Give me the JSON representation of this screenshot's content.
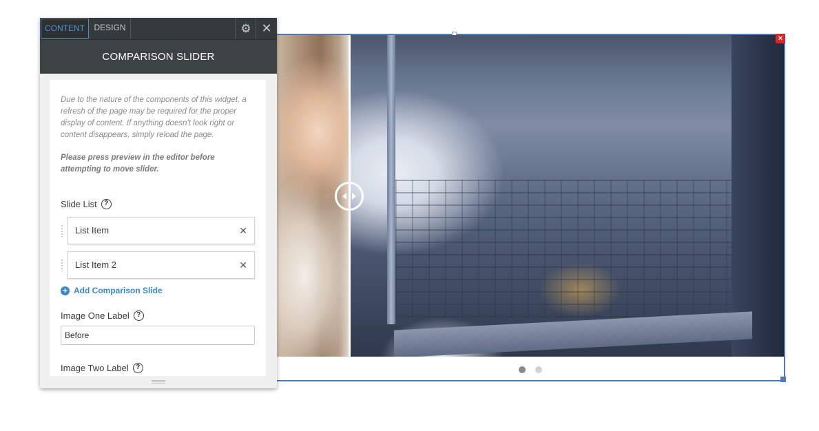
{
  "panel": {
    "tabs": {
      "content": "CONTENT",
      "design": "DESIGN"
    },
    "title": "COMPARISON SLIDER",
    "notice": "Due to the nature of the components of this widget, a refresh of the page may be required for the proper display of content. If anything doesn't look right or content disappears, simply reload the page.",
    "notice_bold": "Please press preview in the editor before attempting to move slider.",
    "slide_list": {
      "label": "Slide List",
      "items": [
        {
          "label": "List Item"
        },
        {
          "label": "List Item 2"
        }
      ],
      "add_label": "Add Comparison Slide"
    },
    "image_one": {
      "label": "Image One Label",
      "value": "Before"
    },
    "image_two": {
      "label": "Image Two Label",
      "value": ""
    }
  },
  "icons": {
    "gear": "gear-icon",
    "close": "close-icon",
    "help": "help-icon",
    "remove": "remove-icon",
    "add": "plus-circle-icon"
  },
  "slider": {
    "active_dot": 1,
    "dot_count": 2
  },
  "colors": {
    "accent": "#4e8fd4",
    "link": "#3a86cf",
    "panel_dark": "#353a3b",
    "widget_border": "#4f79b8",
    "widget_close": "#d9262c"
  }
}
